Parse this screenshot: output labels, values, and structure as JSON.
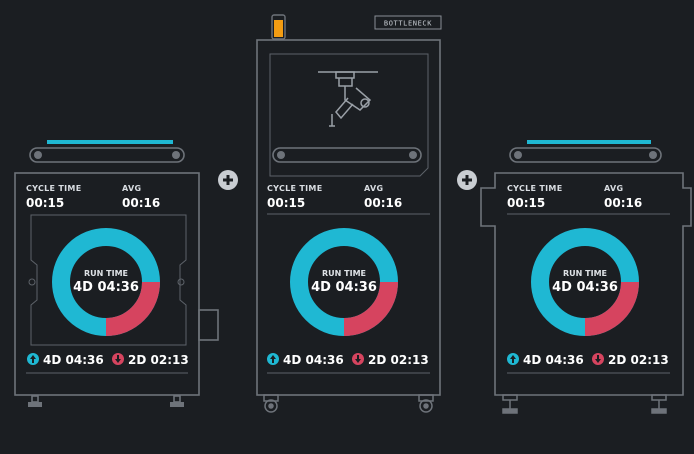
{
  "colors": {
    "background": "#1b1e22",
    "outline": "#6e737a",
    "accent_cyan": "#1fb8d3",
    "accent_red": "#d6445f",
    "bottleneck_orange": "#f39c12"
  },
  "bottleneck_tag": "BOTTLENECK",
  "add_buttons": [
    {
      "icon": "plus-icon"
    },
    {
      "icon": "plus-icon"
    }
  ],
  "machines": [
    {
      "cycle_time_label": "CYCLE TIME",
      "cycle_time_value": "00:15",
      "avg_label": "AVG",
      "avg_value": "00:16",
      "run_time_label": "RUN TIME",
      "run_time_value": "4D 04:36",
      "up_value": "4D 04:36",
      "down_value": "2D 02:13",
      "run_fraction": 0.75
    },
    {
      "cycle_time_label": "CYCLE TIME",
      "cycle_time_value": "00:15",
      "avg_label": "AVG",
      "avg_value": "00:16",
      "run_time_label": "RUN TIME",
      "run_time_value": "4D 04:36",
      "up_value": "4D 04:36",
      "down_value": "2D 02:13",
      "run_fraction": 0.75
    },
    {
      "cycle_time_label": "CYCLE TIME",
      "cycle_time_value": "00:15",
      "avg_label": "AVG",
      "avg_value": "00:16",
      "run_time_label": "RUN TIME",
      "run_time_value": "4D 04:36",
      "up_value": "4D 04:36",
      "down_value": "2D 02:13",
      "run_fraction": 0.75
    }
  ]
}
